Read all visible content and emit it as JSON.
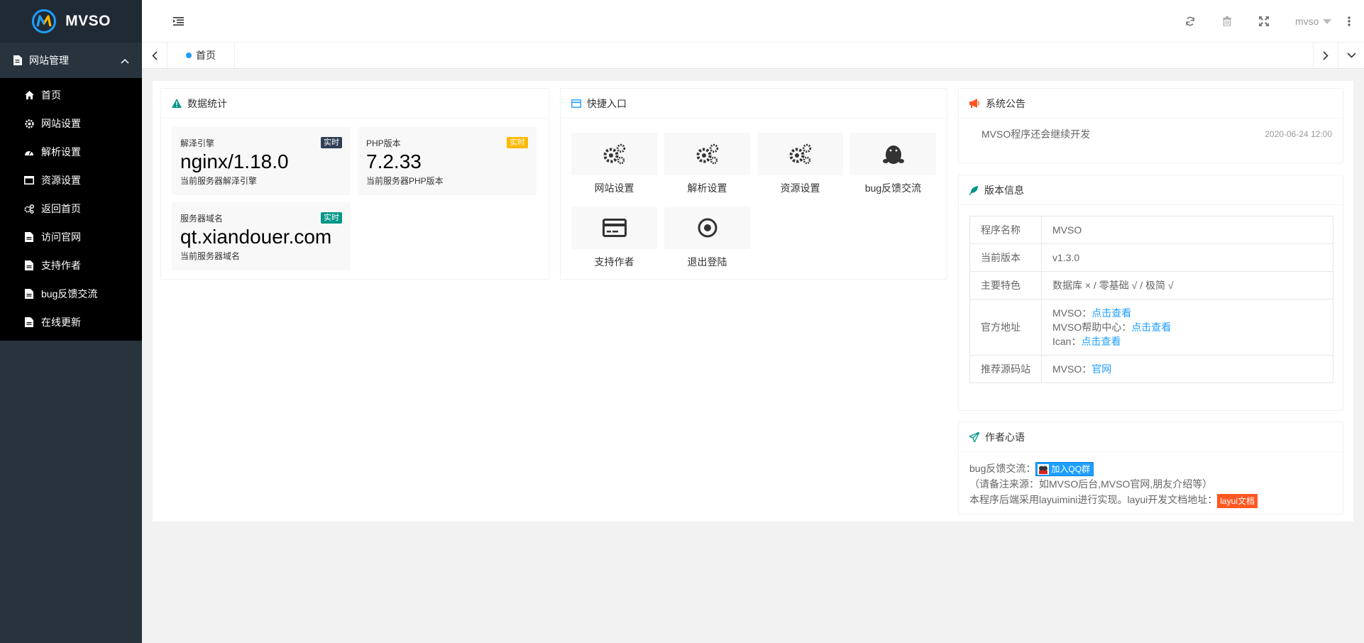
{
  "app": {
    "logo_text": "MVSO"
  },
  "sidebar": {
    "group_label": "网站管理",
    "items": [
      {
        "label": "首页",
        "icon": "home-icon"
      },
      {
        "label": "网站设置",
        "icon": "gear-icon"
      },
      {
        "label": "解析设置",
        "icon": "dashboard-icon"
      },
      {
        "label": "资源设置",
        "icon": "window-icon"
      },
      {
        "label": "返回首页",
        "icon": "gears-icon"
      },
      {
        "label": "访问官网",
        "icon": "file-icon"
      },
      {
        "label": "支持作者",
        "icon": "file-icon"
      },
      {
        "label": "bug反馈交流",
        "icon": "file-icon"
      },
      {
        "label": "在线更新",
        "icon": "file-icon"
      }
    ]
  },
  "header": {
    "user_name": "mvso"
  },
  "tabs": {
    "active": "首页"
  },
  "stats": {
    "title": "数据统计",
    "items": [
      {
        "label": "解泽引擎",
        "value": "nginx/1.18.0",
        "sub": "当前服务器解泽引擎",
        "badge": "实时",
        "badge_color": "#2f4056"
      },
      {
        "label": "PHP版本",
        "value": "7.2.33",
        "sub": "当前服务器PHP版本",
        "badge": "实时",
        "badge_color": "#ffb800"
      },
      {
        "label": "服务器域名",
        "value": "qt.xiandouer.com",
        "sub": "当前服务器域名",
        "badge": "实时",
        "badge_color": "#009688"
      }
    ]
  },
  "quick": {
    "title": "快捷入口",
    "items": [
      {
        "label": "网站设置",
        "icon": "gears-icon"
      },
      {
        "label": "解析设置",
        "icon": "gears-icon"
      },
      {
        "label": "资源设置",
        "icon": "gears-icon"
      },
      {
        "label": "bug反馈交流",
        "icon": "qq-penguin-icon"
      },
      {
        "label": "支持作者",
        "icon": "credit-card-icon"
      },
      {
        "label": "退出登陆",
        "icon": "dot-circle-icon"
      }
    ]
  },
  "notice": {
    "title": "系统公告",
    "text": "MVSO程序还会继续开发",
    "date": "2020-06-24 12:00"
  },
  "version": {
    "title": "版本信息",
    "rows": {
      "name_k": "程序名称",
      "name_v": "MVSO",
      "ver_k": "当前版本",
      "ver_v": "v1.3.0",
      "feat_k": "主要特色",
      "feat_v": "数据库 × / 零基础 √ / 极简 √",
      "site_k": "官方地址",
      "site1_pre": "MVSO：",
      "site1_link": "点击查看",
      "site2_pre": "MVSO帮助中心：",
      "site2_link": "点击查看",
      "site3_pre": "Ican：",
      "site3_link": "点击查看",
      "rec_k": "推荐源码站",
      "rec_pre": "MVSO：",
      "rec_link": "官网"
    }
  },
  "author": {
    "title": "作者心语",
    "line1_pre": "bug反馈交流：",
    "qq_button": "加入QQ群",
    "line1_post": "（请备注来源：如MVSO后台,MVSO官网,朋友介绍等）",
    "line2_pre": "本程序后端采用layuimini进行实现。layui开发文档地址：",
    "doc_button": "layui文档"
  },
  "colors": {
    "sidebar_bg": "#28333e",
    "submenu_bg": "#000000",
    "accent": "#1e9fff",
    "orange": "#ff5722"
  }
}
